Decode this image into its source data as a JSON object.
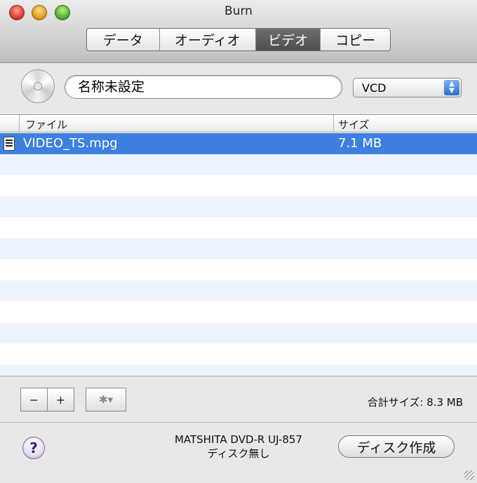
{
  "window": {
    "title": "Burn"
  },
  "tabs": [
    {
      "label": "データ",
      "active": false
    },
    {
      "label": "オーディオ",
      "active": false
    },
    {
      "label": "ビデオ",
      "active": true
    },
    {
      "label": "コピー",
      "active": false
    }
  ],
  "project": {
    "name_value": "名称未設定",
    "format_selected": "VCD"
  },
  "table": {
    "columns": [
      "ファイル",
      "サイズ"
    ],
    "rows": [
      {
        "name": "VIDEO_TS.mpg",
        "size": "7.1 MB",
        "selected": true
      }
    ],
    "empty_rows": 11
  },
  "toolbar": {
    "remove_label": "−",
    "add_label": "+",
    "action_label": "✱▾",
    "total_size": "合計サイズ: 8.3 MB"
  },
  "footer": {
    "help_label": "?",
    "drive_name": "MATSHITA DVD-R UJ-857",
    "disc_status": "ディスク無し",
    "create_button": "ディスク作成"
  },
  "colors": {
    "selection": "#3d80df",
    "stripe": "#edf3fe",
    "active_tab": "#5a5a5a"
  }
}
